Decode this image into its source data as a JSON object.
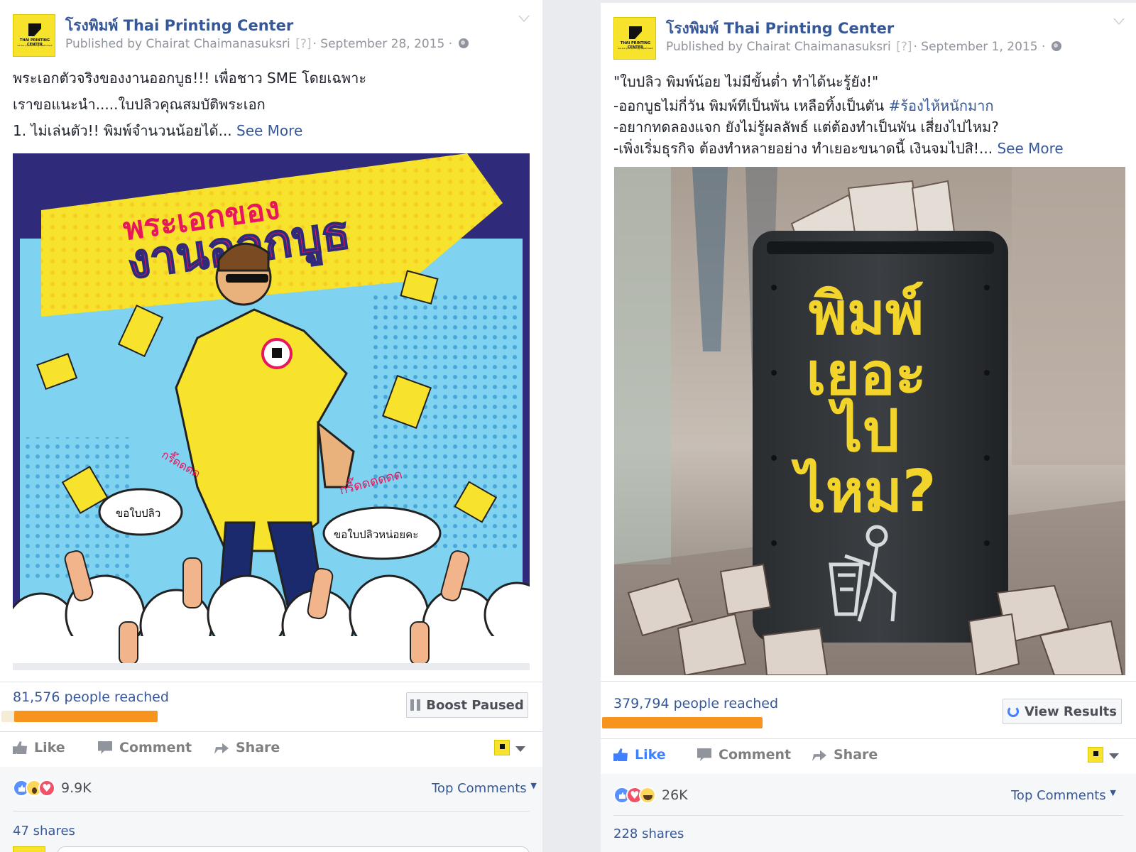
{
  "posts": [
    {
      "page_name": "โรงพิมพ์ Thai Printing Center",
      "published_by": "Published by Chairat Chaimanasuksri",
      "help": "[?]",
      "date": "September 28, 2015",
      "text_lines": [
        "พระเอกตัวจริงของงานออกบูธ!!! เพื่อชาว SME โดยเฉพาะ",
        "เราขอแนะนำ.....ใบปลิวคุณสมบัติพระเอก",
        "1. ไม่เล่นตัว!! พิมพ์จำนวนน้อยได้..."
      ],
      "see_more": "See More",
      "image": {
        "headline_top": "พระเอกของ",
        "headline_main": "งานออกบูธ",
        "bubble_left": "ขอใบปลิว",
        "bubble_right": "ขอใบปลิวหน่อยคะ",
        "shout_left": "กรี๊ดดดด",
        "shout_right": "กรี๊ดดดดดด"
      },
      "reach": "81,576 people reached",
      "reach_bar_fraction": 0.08,
      "boost_label": "Boost Paused",
      "like": "Like",
      "comment": "Comment",
      "share": "Share",
      "liked": false,
      "reactions": [
        "like",
        "wow",
        "love"
      ],
      "reaction_count": "9.9K",
      "top_comments": "Top Comments",
      "shares": "47 shares"
    },
    {
      "page_name": "โรงพิมพ์ Thai Printing Center",
      "published_by": "Published by Chairat Chaimanasuksri",
      "help": "[?]",
      "date": "September 1, 2015",
      "text_lines": [
        "\"ใบปลิว พิมพ์น้อย ไม่มีขั้นต่ำ ทำได้นะรู้ยัง!\"",
        "-ออกบูธไม่กี่วัน พิมพ์ทีเป็นพัน เหลือทิ้งเป็นตัน ",
        "-อยากทดลองแจก ยังไม่รู้ผลลัพธ์ แต่ต้องทำเป็นพัน เสี่ยงไปไหม?",
        "-เพิ่งเริ่มธุรกิจ ต้องทำหลายอย่าง ทำเยอะขนาดนี้ เงินจมไปสิ!..."
      ],
      "hashtag": "#ร้องไห้หนักมาก",
      "see_more": "See More",
      "image": {
        "line1": "พิมพ์",
        "line2": "เยอะ",
        "line3": "ไป",
        "line4": "ไหม?"
      },
      "reach": "379,794 people reached",
      "reach_bar_fraction": 0.0,
      "results_label": "View Results",
      "like": "Like",
      "comment": "Comment",
      "share": "Share",
      "liked": true,
      "reactions": [
        "like",
        "love",
        "haha"
      ],
      "reaction_count": "26K",
      "top_comments": "Top Comments",
      "shares": "228 shares"
    }
  ],
  "colors": {
    "link": "#365899",
    "reach_bar": "#f7941d",
    "brand_yellow": "#f7e32c",
    "liked_blue": "#4080ff"
  }
}
